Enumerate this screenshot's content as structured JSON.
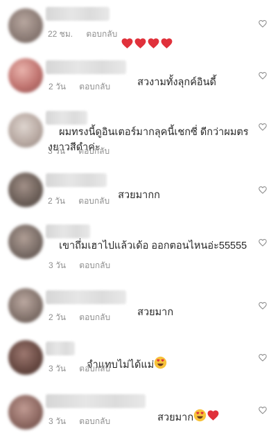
{
  "comments": [
    {
      "text": "",
      "emojis": [
        "heart",
        "heart",
        "heart",
        "heart"
      ],
      "time": "22 ชม.",
      "reply": "ตอบกลับ",
      "avatar_color": "#8a7a74"
    },
    {
      "text": "สวงามทั้งลุกค์อินดี้",
      "emojis": [],
      "time": "2 วัน",
      "reply": "ตอบกลับ",
      "avatar_color": "#c07470"
    },
    {
      "text": "ผมทรงนี้ดูอินเตอร์มากลุคนี้เชกซี่ ดีกว่าผมตรงยาวสีดำค่ะ",
      "emojis": [],
      "time": "3 วัน",
      "reply": "ตอบกลับ",
      "avatar_color": "#b9aaa3"
    },
    {
      "text": "สวยมากก",
      "emojis": [],
      "time": "2 วัน",
      "reply": "ตอบกลับ",
      "avatar_color": "#6e615a"
    },
    {
      "text": "เขาถึ่มเฮาไปแล้วเด้อ ออกตอนไหนอ่ะ55555",
      "emojis": [],
      "time": "3 วัน",
      "reply": "ตอบกลับ",
      "avatar_color": "#7b6e68"
    },
    {
      "text": "สวยมาก",
      "emojis": [],
      "time": "2 วัน",
      "reply": "ตอบกลับ",
      "avatar_color": "#86766f"
    },
    {
      "text": "จำแทบไม่ได้แม่",
      "emojis": [
        "heart-eyes"
      ],
      "time": "3 วัน",
      "reply": "ตอบกลับ",
      "avatar_color": "#6a4b44"
    },
    {
      "text": "สวยมาก",
      "emojis": [
        "heart-eyes",
        "heart"
      ],
      "time": "3 วัน",
      "reply": "ตอบกลับ",
      "avatar_color": "#8f6a63"
    }
  ],
  "colors": {
    "heart_red": "#e0313b",
    "meta_gray": "#8e8e8e",
    "emoji_yellow": "#f7c23a"
  },
  "icons": {
    "like": "heart-outline-icon"
  }
}
